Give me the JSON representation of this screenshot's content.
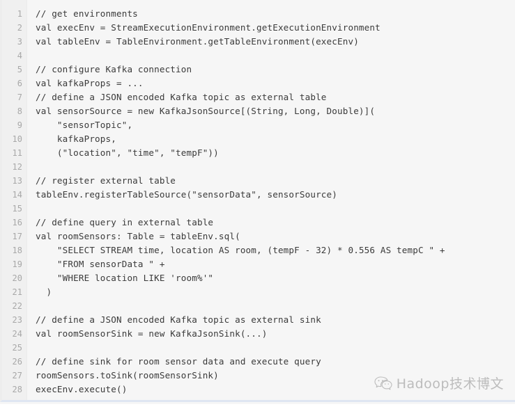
{
  "page": {
    "background_color": "#f6f6f6",
    "code_text_color": "#3a3a3a",
    "gutter_color": "#f0f0f0",
    "line_number_color": "#a8a8a8",
    "bottom_border_color": "#dfe6f2",
    "left_border_color": "#ededed"
  },
  "code_block": {
    "language": "scala",
    "line_numbers": [
      "1",
      "2",
      "3",
      "4",
      "5",
      "6",
      "7",
      "8",
      "9",
      "10",
      "11",
      "12",
      "13",
      "14",
      "15",
      "16",
      "17",
      "18",
      "19",
      "20",
      "21",
      "22",
      "23",
      "24",
      "25",
      "26",
      "27",
      "28"
    ],
    "lines": [
      "// get environments",
      "val execEnv = StreamExecutionEnvironment.getExecutionEnvironment",
      "val tableEnv = TableEnvironment.getTableEnvironment(execEnv)",
      "",
      "// configure Kafka connection",
      "val kafkaProps = ...",
      "// define a JSON encoded Kafka topic as external table",
      "val sensorSource = new KafkaJsonSource[(String, Long, Double)](",
      "    \"sensorTopic\",",
      "    kafkaProps,",
      "    (\"location\", \"time\", \"tempF\"))",
      "",
      "// register external table",
      "tableEnv.registerTableSource(\"sensorData\", sensorSource)",
      "",
      "// define query in external table",
      "val roomSensors: Table = tableEnv.sql(",
      "    \"SELECT STREAM time, location AS room, (tempF - 32) * 0.556 AS tempC \" +",
      "    \"FROM sensorData \" +",
      "    \"WHERE location LIKE 'room%'\"",
      "  )",
      "",
      "// define a JSON encoded Kafka topic as external sink",
      "val roomSensorSink = new KafkaJsonSink(...)",
      "",
      "// define sink for room sensor data and execute query",
      "roomSensors.toSink(roomSensorSink)",
      "execEnv.execute()"
    ]
  },
  "watermark": {
    "icon": "wechat-icon",
    "text": "Hadoop技术博文",
    "color": "#8d8d8d"
  }
}
